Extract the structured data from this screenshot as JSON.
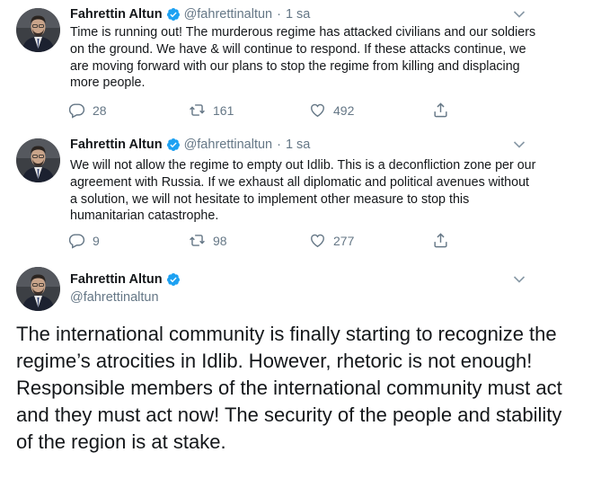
{
  "tweets": [
    {
      "name": "Fahrettin Altun",
      "handle": "@fahrettinaltun",
      "dot": "·",
      "time": "1 sa",
      "text": "Time is running out! The murderous regime has attacked civilians and our soldiers on the ground. We have & will continue to respond. If these attacks continue, we are moving forward with our plans to stop the regime from killing and displacing more people.",
      "replies": "28",
      "retweets": "161",
      "likes": "492"
    },
    {
      "name": "Fahrettin Altun",
      "handle": "@fahrettinaltun",
      "dot": "·",
      "time": "1 sa",
      "text": "We will not allow the regime to empty out Idlib. This is a deconfliction zone per our agreement with Russia. If we exhaust all diplomatic and political avenues without a solution, we will not hesitate to implement other measure to stop this humanitarian catastrophe.",
      "replies": "9",
      "retweets": "98",
      "likes": "277"
    },
    {
      "name": "Fahrettin Altun",
      "handle": "@fahrettinaltun",
      "text": "The international community is finally starting to recognize the regime’s atrocities in Idlib. However, rhetoric is not enough! Responsible members of the international community must act and they must act now! The security of the people and stability of the region is at stake."
    }
  ],
  "icons": {
    "verified": "verified-badge-icon",
    "caret": "chevron-down-icon",
    "reply": "reply-icon",
    "retweet": "retweet-icon",
    "like": "heart-icon",
    "share": "share-icon"
  },
  "colors": {
    "verified_blue": "#1da1f2",
    "secondary_text": "#657786",
    "primary_text": "#14171a"
  }
}
